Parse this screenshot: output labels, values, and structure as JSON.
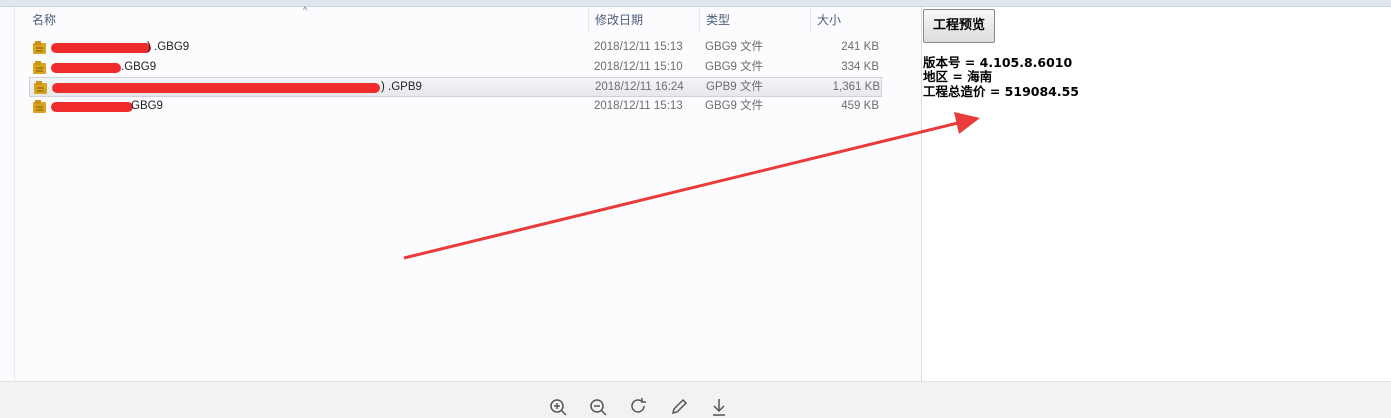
{
  "explorer": {
    "columns": {
      "name": "名称",
      "date": "修改日期",
      "type": "类型",
      "size": "大小"
    },
    "files": [
      {
        "name": ") .GBG9",
        "date": "2018/12/11 15:13",
        "type": "GBG9 文件",
        "size": "241 KB"
      },
      {
        "name": " .GBG9",
        "date": "2018/12/11 15:10",
        "type": "GBG9 文件",
        "size": "334 KB"
      },
      {
        "name": ") .GPB9",
        "date": "2018/12/11 16:24",
        "type": "GPB9 文件",
        "size": "1,361 KB"
      },
      {
        "name": "GBG9",
        "date": "2018/12/11 15:13",
        "type": "GBG9 文件",
        "size": "459 KB"
      }
    ]
  },
  "preview": {
    "button_label": "工程预览",
    "version_line": "版本号 = 4.105.8.6010",
    "region_line": "地区 = 海南",
    "total_line": "工程总造价 = 519084.55"
  },
  "icons": {
    "file": "file-icon",
    "zoom_in": "zoom-in-icon",
    "zoom_out": "zoom-out-icon",
    "rotate": "rotate-icon",
    "edit": "pencil-icon",
    "download": "download-icon"
  },
  "colors": {
    "annotation": "#ea3b3b",
    "redaction": "#ef2b2b",
    "selected_row": "#e6e8ec"
  }
}
